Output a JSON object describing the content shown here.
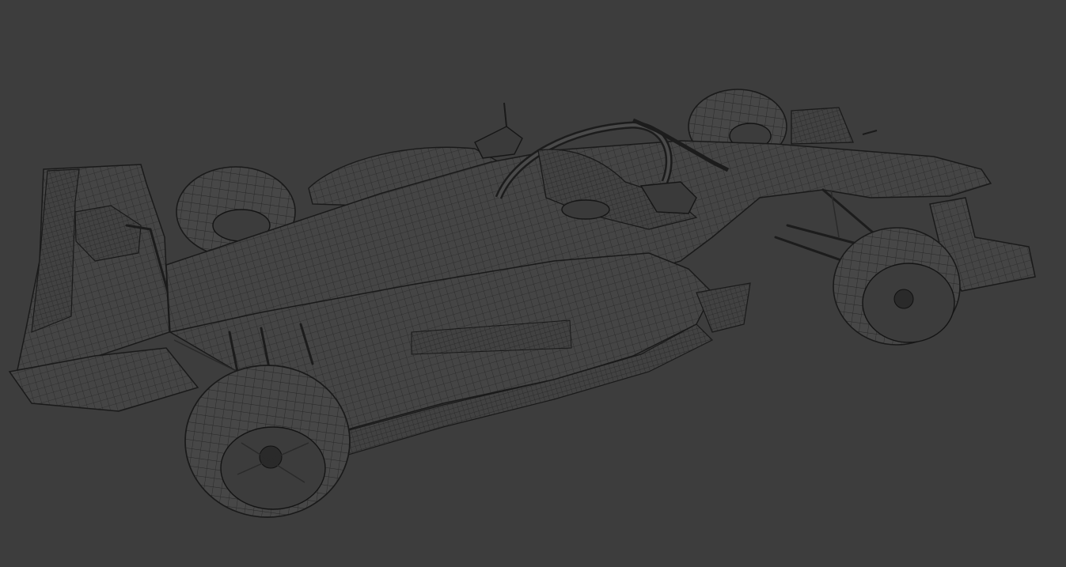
{
  "viewport": {
    "background": "#3d3d3d",
    "mesh_color": "#1d1d1d",
    "surface_color": "#454545",
    "render_mode": "wireframe"
  },
  "model": {
    "icon": "race-car-wireframe-icon",
    "wheels": 4
  }
}
